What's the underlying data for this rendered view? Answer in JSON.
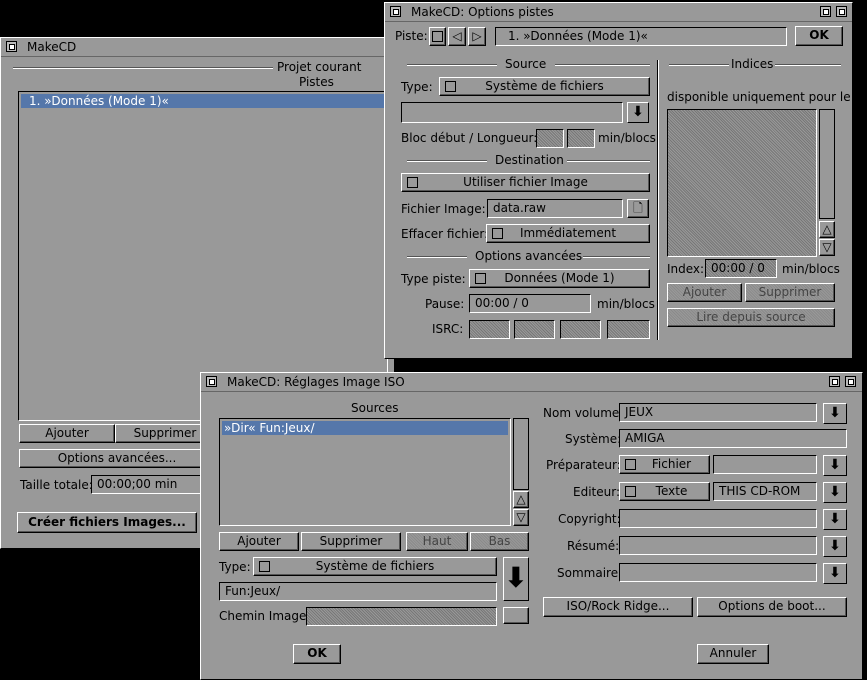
{
  "main_window": {
    "title": "MakeCD",
    "group_title": "Projet courant",
    "tracks_label": "Pistes",
    "tracks": [
      "1. »Données (Mode 1)«"
    ],
    "add": "Ajouter",
    "remove": "Supprimer",
    "advanced": "Options avancées...",
    "total_size_label": "Taille totale:",
    "total_size_value": "00:00;00 min",
    "create_images": "Créer fichiers Images..."
  },
  "options_window": {
    "title": "MakeCD: Options pistes",
    "track_label": "Piste:",
    "track_value": "1. »Données (Mode 1)«",
    "ok": "OK",
    "source_group": "Source",
    "type_label": "Type:",
    "type_value": "Système de fichiers",
    "block_label": "Bloc début / Longueur:",
    "block_unit": "min/blocs",
    "destination_group": "Destination",
    "dest_value": "Utiliser fichier Image",
    "image_file_label": "Fichier Image:",
    "image_file_value": "data.raw",
    "delete_label": "Effacer fichier:",
    "delete_value": "Immédiatement",
    "advanced_group": "Options avancées",
    "track_type_label": "Type piste:",
    "track_type_value": "Données (Mode 1)",
    "pause_label": "Pause:",
    "pause_value": "00:00 / 0",
    "pause_unit": "min/blocs",
    "isrc_label": "ISRC:",
    "indices_group": "Indices",
    "indices_note": "disponible uniquement pour le",
    "index_label": "Index:",
    "index_value": "00:00 / 0",
    "index_unit": "min/blocs",
    "add": "Ajouter",
    "remove": "Supprimer",
    "read_source": "Lire depuis source"
  },
  "iso_window": {
    "title": "MakeCD: Réglages Image ISO",
    "sources_label": "Sources",
    "sources": [
      "»Dir« Fun:Jeux/"
    ],
    "add": "Ajouter",
    "remove": "Supprimer",
    "up": "Haut",
    "down": "Bas",
    "type_label": "Type:",
    "type_value": "Système de fichiers",
    "path_value": "Fun:Jeux/",
    "image_path_label": "Chemin Image:",
    "volume_label": "Nom volume:",
    "volume_value": "JEUX",
    "system_label": "Système:",
    "system_value": "AMIGA",
    "preparer_label": "Préparateur:",
    "preparer_mode": "Fichier",
    "publisher_label": "Editeur:",
    "publisher_mode": "Texte",
    "publisher_value": "THIS CD-ROM",
    "copyright_label": "Copyright:",
    "abstract_label": "Résumé:",
    "summary_label": "Sommaire:",
    "iso_rr": "ISO/Rock Ridge...",
    "boot": "Options de boot...",
    "ok": "OK",
    "cancel": "Annuler"
  }
}
